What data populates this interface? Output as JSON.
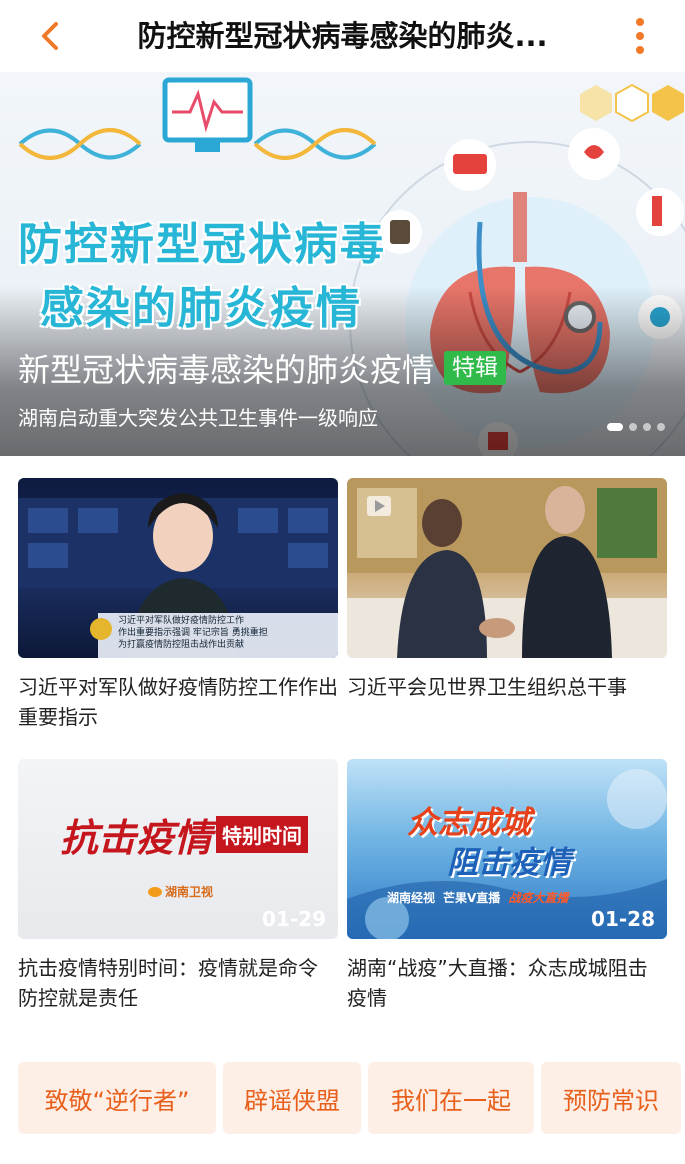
{
  "header": {
    "title": "防控新型冠状病毒感染的肺炎...",
    "back_icon": "chevron-left-icon",
    "more_icon": "more-vertical-icon",
    "accent_color": "#f07a2a"
  },
  "banner": {
    "art_line1": "防控新型冠状病毒",
    "art_line2": "感染的肺炎疫情",
    "headline": "新型冠状病毒感染的肺炎疫情",
    "tag": "特辑",
    "subtitle": "湖南启动重大突发公共卫生事件一级响应",
    "carousel_count": 4,
    "carousel_active": 1
  },
  "cards": [
    {
      "title": "习近平对军队做好疫情防控工作作出重要指示",
      "overlay_lines": [
        "习近平对军队做好疫情防控工作",
        "作出重要指示强调 牢记宗旨 勇挑重担",
        "为打赢疫情防控阻击战作出贡献"
      ],
      "date": ""
    },
    {
      "title": "习近平会见世界卫生组织总干事",
      "date": ""
    },
    {
      "title": "抗击疫情特别时间：疫情就是命令 防控就是责任",
      "art_main": "抗击疫情",
      "art_box": "特别时间",
      "art_logo": "湖南卫视",
      "date": "01-29"
    },
    {
      "title": "湖南“战疫”大直播：众志成城阻击疫情",
      "art_line1": "众志成城",
      "art_line2": "阻击疫情",
      "art_logo1": "湖南经视",
      "art_logo2": "芒果V直播",
      "art_logo3": "战疫大直播",
      "date": "01-28"
    }
  ],
  "tags": [
    "致敬“逆行者”",
    "辟谣侠盟",
    "我们在一起",
    "预防常识"
  ],
  "colors": {
    "tag_bg": "#fdeee6",
    "tag_text": "#e8601c",
    "special_tag": "#2fba4a"
  }
}
